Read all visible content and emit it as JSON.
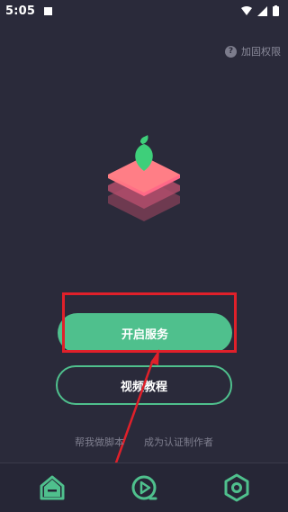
{
  "status_bar": {
    "time": "5:05"
  },
  "header": {
    "permission_link": "加固权限"
  },
  "actions": {
    "start_service": "开启服务",
    "video_tutorial": "视频教程"
  },
  "links": {
    "help_script": "帮我做脚本",
    "become_author": "成为认证制作者"
  },
  "nav": {
    "items": [
      "home-icon",
      "play-icon",
      "settings-icon"
    ]
  },
  "colors": {
    "background": "#2a2a3a",
    "accent": "#4fc08d",
    "highlight": "#e0202a"
  }
}
